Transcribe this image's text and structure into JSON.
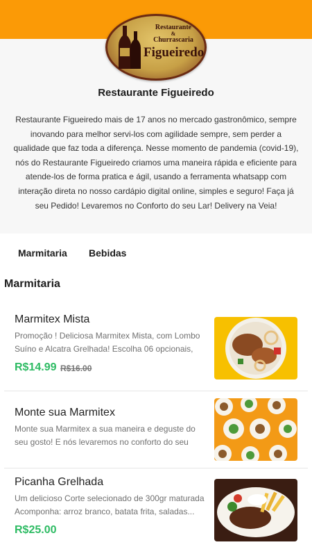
{
  "colors": {
    "brand": "#fb9a06",
    "price": "#2dbb63"
  },
  "logo": {
    "icon": "bottles-logo-icon",
    "line1": "Restaurante",
    "line2": "&",
    "line3": "Churrascaria",
    "line4": "Figueiredo"
  },
  "restaurant": {
    "name": "Restaurante Figueiredo",
    "description": "Restaurante Figueiredo mais de 17 anos no mercado gastronômico, sempre inovando para melhor servi-los com agilidade sempre, sem perder a qualidade que faz toda a diferença. Nesse momento de pandemia (covid-19), nós do Restaurante Figueiredo criamos uma maneira rápida e eficiente para atende-los de forma pratica e ágil, usando a ferramenta whatsapp com interação direta no nosso cardápio digital online, simples e seguro! Faça já seu Pedido! Levaremos no Conforto do seu Lar! Delivery na Veia!"
  },
  "tabs": [
    {
      "label": "Marmitaria"
    },
    {
      "label": "Bebidas"
    }
  ],
  "section": {
    "title": "Marmitaria"
  },
  "items": [
    {
      "name": "Marmitex Mista",
      "description": "Promoção ! Deliciosa Marmitex Mista, com Lombo Suíno e Alcatra Grelhada! Escolha 06 opcionais, pa...",
      "price": "R$14.99",
      "old_price": "R$16.00",
      "image": "mixed-plate-photo"
    },
    {
      "name": "Monte sua Marmitex",
      "description": "Monte sua Marmitex a sua maneira e deguste do seu gosto! E nós levaremos no conforto do seu Lar...",
      "image": "multiple-plates-photo"
    },
    {
      "name": "Picanha Grelhada",
      "description": "Um delicioso Corte selecionado de 300gr maturada Acomponha: arroz branco, batata frita, saladas...",
      "price": "R$25.00",
      "image": "picanha-plate-photo"
    }
  ]
}
